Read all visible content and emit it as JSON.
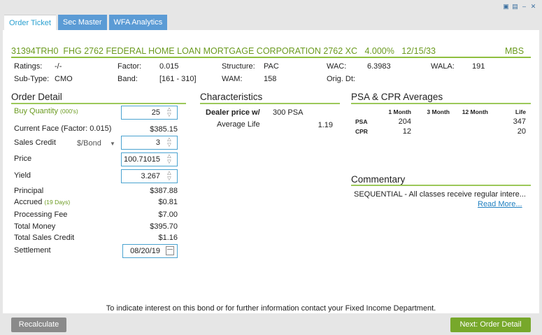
{
  "tabs": [
    {
      "label": "Order Ticket",
      "active": true
    },
    {
      "label": "Sec Master",
      "active": false
    },
    {
      "label": "WFA Analytics",
      "active": false
    }
  ],
  "security": {
    "title": "31394TRH0  FHG 2762 FEDERAL HOME LOAN MORTGAGE CORPORATION 2762 XC   4.000%   12/15/33",
    "type": "MBS"
  },
  "info": {
    "ratings_label": "Ratings:",
    "ratings": "-/-",
    "subtype_label": "Sub-Type:",
    "subtype": "CMO",
    "factor_label": "Factor:",
    "factor": "0.015",
    "band_label": "Band:",
    "band": "[161 - 310]",
    "structure_label": "Structure:",
    "structure": "PAC",
    "wam_label": "WAM:",
    "wam": "158",
    "wac_label": "WAC:",
    "wac": "6.3983",
    "origdt_label": "Orig. Dt:",
    "wala_label": "WALA:",
    "wala": "191"
  },
  "order_detail": {
    "title": "Order Detail",
    "buy_qty_label": "Buy Quantity",
    "buy_qty_unit": "(000's)",
    "buy_qty": "25",
    "current_face_label": "Current Face (Factor: 0.015)",
    "current_face": "$385.15",
    "sales_credit_label": "Sales Credit",
    "sales_credit_unit": "$/Bond",
    "sales_credit": "3",
    "price_label": "Price",
    "price": "100.71015",
    "yield_label": "Yield",
    "yield": "3.267",
    "principal_label": "Principal",
    "principal": "$387.88",
    "accrued_label": "Accrued",
    "accrued_days": "(19 Days)",
    "accrued": "$0.81",
    "processing_fee_label": "Processing Fee",
    "processing_fee": "$7.00",
    "total_money_label": "Total Money",
    "total_money": "$395.70",
    "total_sales_credit_label": "Total Sales Credit",
    "total_sales_credit": "$1.16",
    "settlement_label": "Settlement",
    "settlement": "08/20/19"
  },
  "characteristics": {
    "title": "Characteristics",
    "dealer_price_label": "Dealer price w/",
    "dealer_price": "300 PSA",
    "avg_life_label": "Average Life",
    "avg_life": "1.19"
  },
  "psa": {
    "title": "PSA & CPR Averages",
    "columns": [
      "1 Month",
      "3 Month",
      "12 Month",
      "Life"
    ],
    "rows": [
      {
        "label": "PSA",
        "m1": "204",
        "m3": "",
        "m12": "",
        "life": "347"
      },
      {
        "label": "CPR",
        "m1": "12",
        "m3": "",
        "m12": "",
        "life": "20"
      }
    ]
  },
  "commentary": {
    "title": "Commentary",
    "text": "SEQUENTIAL - All classes receive regular intere...",
    "read_more": "Read More..."
  },
  "footer_note": "To indicate interest on this bond or for further information contact your Fixed Income Department.",
  "buttons": {
    "recalculate": "Recalculate",
    "next": "Next: Order Detail"
  },
  "colors": {
    "accent_green": "#6a9a1f",
    "tab_blue": "#5b9bd5",
    "button_green": "#77a82b",
    "button_gray": "#8a8a8a"
  }
}
